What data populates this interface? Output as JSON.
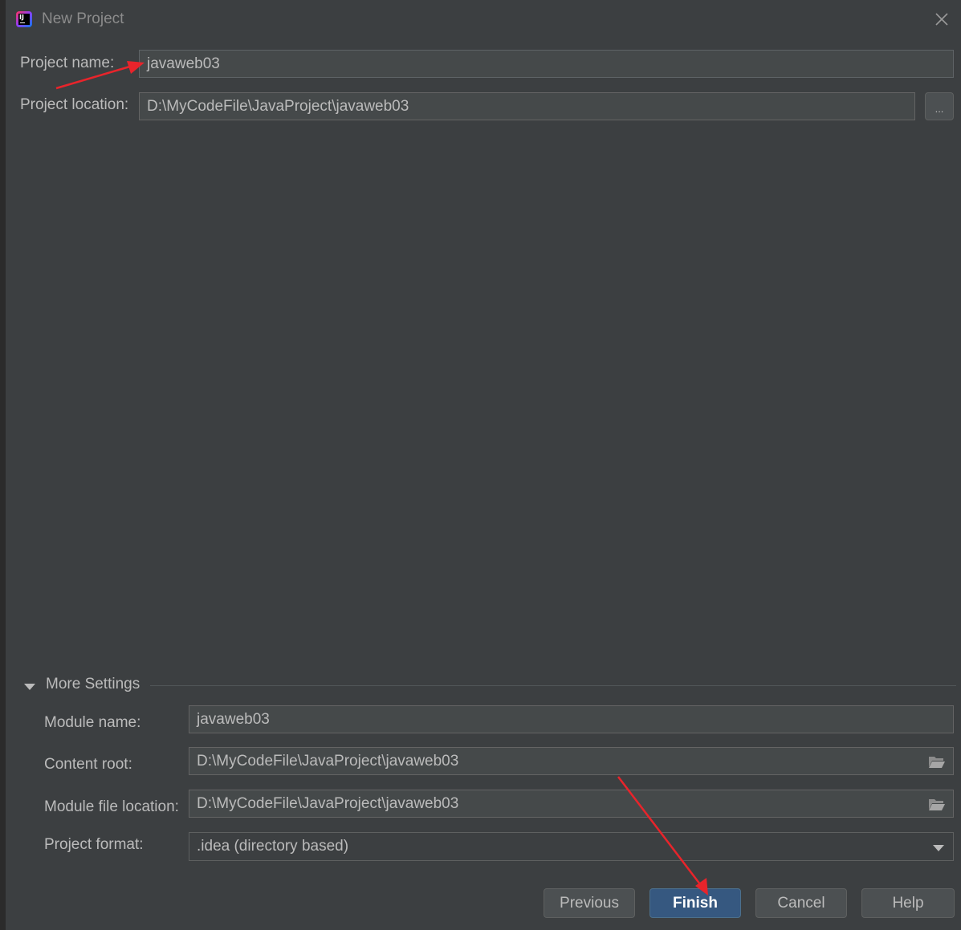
{
  "window": {
    "title": "New Project"
  },
  "project": {
    "name_label": "Project name:",
    "name_value": "javaweb03",
    "location_label": "Project location:",
    "location_value": "D:\\MyCodeFile\\JavaProject\\javaweb03",
    "browse_label": "..."
  },
  "more_settings": {
    "header": "More Settings",
    "module_name_label": "Module name:",
    "module_name_value": "javaweb03",
    "content_root_label": "Content root:",
    "content_root_value": "D:\\MyCodeFile\\JavaProject\\javaweb03",
    "module_file_label": "Module file location:",
    "module_file_value": "D:\\MyCodeFile\\JavaProject\\javaweb03",
    "format_label": "Project format:",
    "format_value": ".idea (directory based)"
  },
  "buttons": {
    "previous": "Previous",
    "finish": "Finish",
    "cancel": "Cancel",
    "help": "Help"
  },
  "colors": {
    "background": "#3c3f41",
    "field": "#45494a",
    "primary_button": "#365880",
    "annotation_arrow": "#e8242b"
  }
}
